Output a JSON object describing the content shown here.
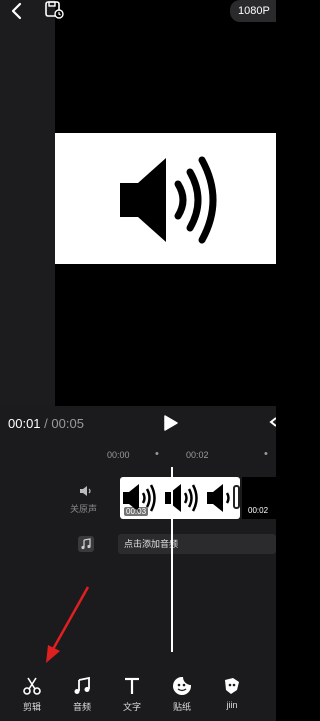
{
  "header": {
    "back_icon": "chevron-left-icon",
    "save_icon": "save-draft-icon",
    "resolution": "1080P"
  },
  "player": {
    "current_time": "00:01",
    "separator": " / ",
    "total_time": "00:05"
  },
  "timeline": {
    "ruler": [
      "00:00",
      "00:02"
    ],
    "audio_track_label": "关原声",
    "clip_time": "00:03",
    "next_clip_time": "00:02",
    "add_audio_label": "点击添加音频"
  },
  "toolbar": {
    "items": [
      {
        "label": "剪辑",
        "icon": "scissors-icon"
      },
      {
        "label": "音频",
        "icon": "music-note-icon"
      },
      {
        "label": "文字",
        "icon": "text-icon"
      },
      {
        "label": "贴纸",
        "icon": "sticker-icon"
      },
      {
        "label": "jiin",
        "icon": "more-icon"
      }
    ]
  },
  "colors": {
    "background": "#000000",
    "panel": "#1b1b1d",
    "annotation_arrow": "#e02020"
  }
}
